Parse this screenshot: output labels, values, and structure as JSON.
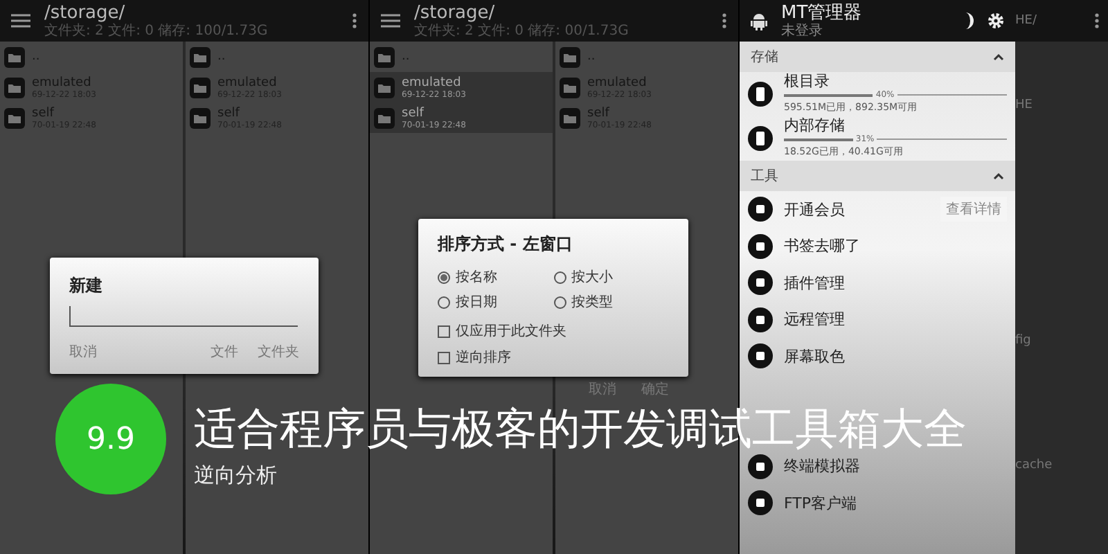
{
  "panels": [
    {
      "kind": "files",
      "path": "/storage/",
      "summary": "文件夹: 2 文件: 0 储存: 100/1.73G",
      "panes": [
        {
          "rows": [
            {
              "name": "..",
              "selected": false
            },
            {
              "name": "emulated",
              "date": "69-12-22 18:03",
              "selected": false
            },
            {
              "name": "self",
              "date": "70-01-19 22:48",
              "selected": false
            }
          ]
        },
        {
          "rows": [
            {
              "name": "..",
              "selected": false
            },
            {
              "name": "emulated",
              "date": "69-12-22 18:03",
              "selected": false
            },
            {
              "name": "self",
              "date": "70-01-19 22:48",
              "selected": false
            }
          ]
        }
      ],
      "dialog": {
        "kind": "new",
        "title": "新建",
        "buttons": [
          "取消",
          "文件",
          "文件夹"
        ]
      }
    },
    {
      "kind": "files",
      "path": "/storage/",
      "summary": "文件夹: 2 文件: 0 储存: 00/1.73G",
      "panes": [
        {
          "rows": [
            {
              "name": "..",
              "selected": false
            },
            {
              "name": "emulated",
              "date": "69-12-22 18:03",
              "selected": true
            },
            {
              "name": "self",
              "date": "70-01-19 22:48",
              "selected": true
            }
          ]
        },
        {
          "rows": [
            {
              "name": "..",
              "selected": false
            },
            {
              "name": "emulated",
              "date": "69-12-22 18:03",
              "selected": false
            },
            {
              "name": "self",
              "date": "70-01-19 22:48",
              "selected": false
            }
          ]
        }
      ],
      "dialog": {
        "kind": "sort",
        "title": "排序方式 - 左窗口",
        "radios": [
          {
            "label": "按名称",
            "selected": true
          },
          {
            "label": "按大小",
            "selected": false
          },
          {
            "label": "按日期",
            "selected": false
          },
          {
            "label": "按类型",
            "selected": false
          }
        ],
        "checkboxes": [
          {
            "label": "仅应用于此文件夹",
            "checked": false
          },
          {
            "label": "逆向排序",
            "checked": false
          }
        ],
        "buttons": [
          "取消",
          "确定"
        ]
      }
    },
    {
      "kind": "drawer",
      "app_title": "MT管理器",
      "account": "未登录",
      "background_texts": [
        "HE/",
        "HE",
        "fig",
        "cache"
      ],
      "sections": [
        {
          "title": "存储",
          "expanded": true,
          "items": [
            {
              "kind": "storage",
              "label": "根目录",
              "level": 0.4,
              "percent": "40%",
              "usage": "595.51M已用，892.35M可用"
            },
            {
              "kind": "storage",
              "label": "内部存储",
              "level": 0.31,
              "percent": "31%",
              "usage": "18.52G已用，40.41G可用"
            }
          ]
        },
        {
          "title": "工具",
          "expanded": true,
          "items": [
            {
              "kind": "tool",
              "label": "开通会员",
              "action": "查看详情"
            },
            {
              "kind": "tool",
              "label": "书签去哪了"
            },
            {
              "kind": "tool",
              "label": "插件管理"
            },
            {
              "kind": "tool",
              "label": "远程管理"
            },
            {
              "kind": "tool",
              "label": "屏幕取色"
            },
            {
              "kind": "covered"
            },
            {
              "kind": "covered"
            },
            {
              "kind": "tool",
              "label": "终端模拟器"
            },
            {
              "kind": "tool",
              "label": "FTP客户端"
            }
          ]
        }
      ]
    }
  ],
  "score": "9.9",
  "headline": "适合程序员与极客的开发调试工具箱大全",
  "category": "逆向分析"
}
